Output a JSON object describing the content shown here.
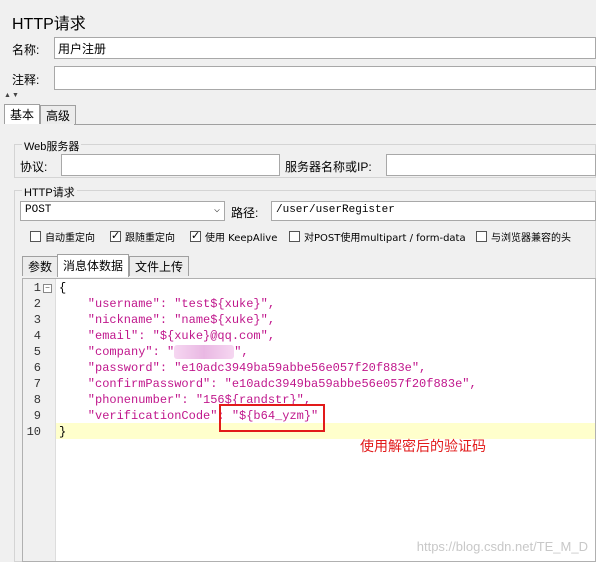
{
  "window": {
    "title": "HTTP请求"
  },
  "form": {
    "name_label": "名称:",
    "name_value": "用户注册",
    "comment_label": "注释:",
    "comment_value": ""
  },
  "tabs": [
    {
      "label": "基本"
    },
    {
      "label": "高级"
    }
  ],
  "web_server": {
    "section_title": "Web服务器",
    "protocol_label": "协议:",
    "protocol_value": "",
    "server_label": "服务器名称或IP:",
    "server_value": ""
  },
  "http_request": {
    "section_title": "HTTP请求",
    "method": "POST",
    "path_label": "路径:",
    "path_value": "/user/userRegister"
  },
  "options": [
    {
      "label": "自动重定向",
      "checked": false
    },
    {
      "label": "跟随重定向",
      "checked": true
    },
    {
      "label": "使用 KeepAlive",
      "checked": true
    },
    {
      "label": "对POST使用multipart / form-data",
      "checked": false
    },
    {
      "label": "与浏览器兼容的头",
      "checked": false
    }
  ],
  "body_tabs": [
    {
      "label": "参数"
    },
    {
      "label": "消息体数据"
    },
    {
      "label": "文件上传"
    }
  ],
  "editor": {
    "line_numbers": [
      "1",
      "2",
      "3",
      "4",
      "5",
      "6",
      "7",
      "8",
      "9",
      "10"
    ],
    "lines": [
      "{",
      "    \"username\": \"test${xuke}\",",
      "    \"nickname\": \"name${xuke}\",",
      "    \"email\": \"${xuke}@qq.com\",",
      "    \"company\": \"",
      "    \"password\": \"e10adc3949ba59abbe56e057f20f883e\",",
      "    \"confirmPassword\": \"e10adc3949ba59abbe56e057f20f883e\",",
      "    \"phonenumber\": \"156${randstr}\",",
      "    \"verificationCode\": \"${b64_yzm}\"",
      "}"
    ],
    "company_suffix": "\","
  },
  "annotation": {
    "text": "使用解密后的验证码",
    "color": "#e21a1a"
  },
  "watermark": "https://blog.csdn.net/TE_M_D"
}
